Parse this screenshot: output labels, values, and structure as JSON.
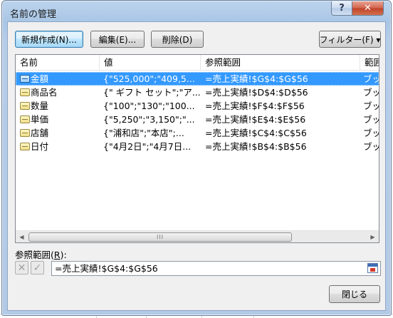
{
  "window": {
    "title": "名前の管理"
  },
  "titlebar": {
    "help_glyph": "?",
    "close_glyph": "✕"
  },
  "toolbar": {
    "new_label": "新規作成(N)...",
    "edit_label": "編集(E)...",
    "delete_label": "削除(D)",
    "filter_label": "フィルター(F) ▾"
  },
  "list": {
    "columns": [
      "名前",
      "値",
      "参照範囲",
      "範囲"
    ],
    "rows": [
      {
        "name": "金額",
        "value": "{\"525,000\";\"409,5...",
        "ref": "=売上実績!$G$4:$G$56",
        "scope": "ブッ",
        "selected": true
      },
      {
        "name": "商品名",
        "value": "{\" ギフト セット\";\"ア...",
        "ref": "=売上実績!$D$4:$D$56",
        "scope": "ブッ",
        "selected": false
      },
      {
        "name": "数量",
        "value": "{\"100\";\"130\";\"100...",
        "ref": "=売上実績!$F$4:$F$56",
        "scope": "ブッ",
        "selected": false
      },
      {
        "name": "単価",
        "value": "{\"5,250\";\"3,150\";\"...",
        "ref": "=売上実績!$E$4:$E$56",
        "scope": "ブッ",
        "selected": false
      },
      {
        "name": "店舗",
        "value": "{\"浦和店\";\"本店\";...",
        "ref": "=売上実績!$C$4:$C$56",
        "scope": "ブッ",
        "selected": false
      },
      {
        "name": "日付",
        "value": "{\"4月2日\";\"4月7日...",
        "ref": "=売上実績!$B$4:$B$56",
        "scope": "ブッ",
        "selected": false
      }
    ]
  },
  "scrollbar": {
    "left_arrow": "◀",
    "right_arrow": "▶",
    "grip": "III"
  },
  "ref_field": {
    "label_prefix": "参照範囲(",
    "label_key": "R",
    "label_suffix": "):",
    "cancel_glyph": "✕",
    "accept_glyph": "✓",
    "value": "=売上実績!$G$4:$G$56"
  },
  "footer": {
    "close_label": "閉じる"
  }
}
